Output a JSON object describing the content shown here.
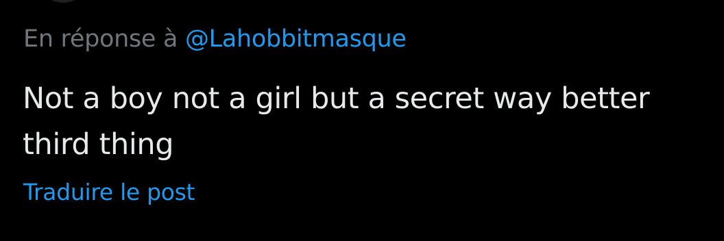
{
  "reply": {
    "prefix": "En réponse à",
    "mention": "@Lahobbitmasque"
  },
  "post": {
    "text": "Not a boy not a girl but a secret way better third thing"
  },
  "translate": {
    "label": "Traduire le post"
  },
  "colors": {
    "background": "#000000",
    "primary_text": "#e7e9ea",
    "secondary_text": "#71767b",
    "accent": "#1d9bf0"
  }
}
